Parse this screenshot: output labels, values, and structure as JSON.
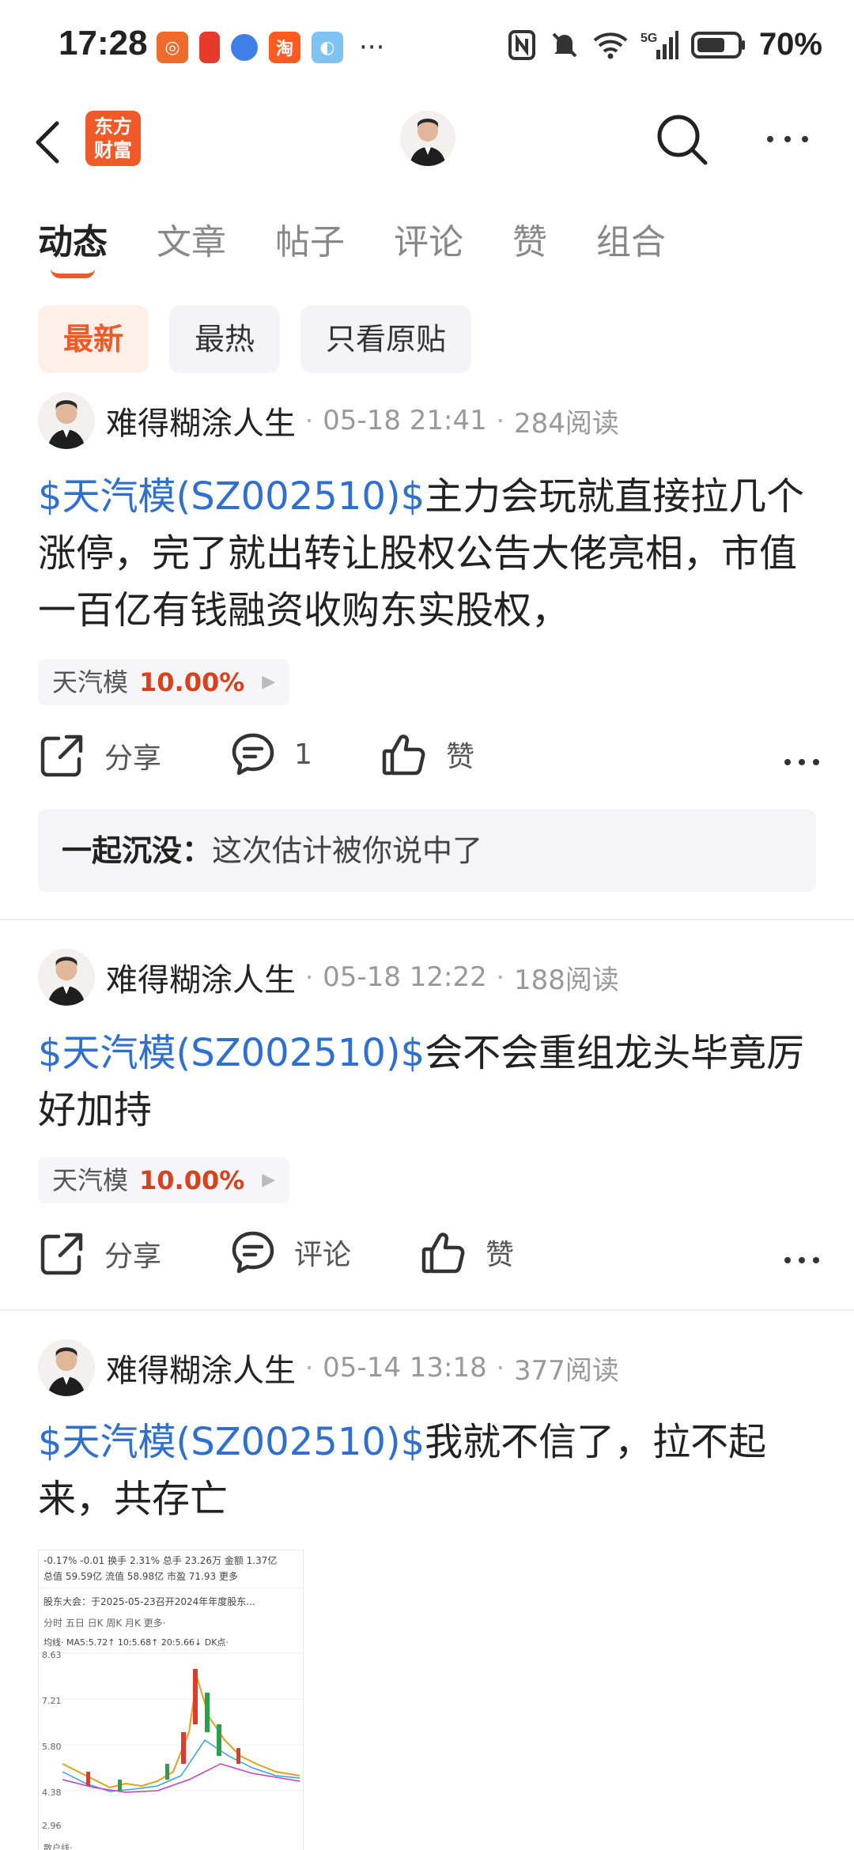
{
  "status_bar": {
    "time": "17:28",
    "battery": "70%",
    "network": "5G"
  },
  "header": {
    "logo_text_1": "东方",
    "logo_text_2": "财富"
  },
  "tabs": [
    {
      "label": "动态",
      "active": true
    },
    {
      "label": "文章"
    },
    {
      "label": "帖子"
    },
    {
      "label": "评论"
    },
    {
      "label": "赞"
    },
    {
      "label": "组合"
    }
  ],
  "filters": [
    {
      "label": "最新",
      "active": true
    },
    {
      "label": "最热"
    },
    {
      "label": "只看原贴"
    }
  ],
  "posts": [
    {
      "author": "难得糊涂人生",
      "time": "05-18 21:41",
      "reads": "284阅读",
      "stock_link": "$天汽模(SZ002510)$",
      "text": "主力会玩就直接拉几个涨停，完了就出转让股权公告大佬亮相，市值一百亿有钱融资收购东实股权，",
      "stock_name": "天汽模",
      "stock_change": "10.00%",
      "share_label": "分享",
      "comment_label": "1",
      "like_label": "赞",
      "comment": {
        "author": "一起沉没",
        "sep": "：",
        "text": "这次估计被你说中了"
      }
    },
    {
      "author": "难得糊涂人生",
      "time": "05-18 12:22",
      "reads": "188阅读",
      "stock_link": "$天汽模(SZ002510)$",
      "text": "会不会重组龙头毕竟厉好加持",
      "stock_name": "天汽模",
      "stock_change": "10.00%",
      "share_label": "分享",
      "comment_label": "评论",
      "like_label": "赞"
    },
    {
      "author": "难得糊涂人生",
      "time": "05-14 13:18",
      "reads": "377阅读",
      "stock_link": "$天汽模(SZ002510)$",
      "text": "我就不信了，拉不起来，共存亡"
    }
  ],
  "thumbnail": {
    "row1": "-0.17%  -0.01  换手 2.31%  总手 23.26万  金额 1.37亿",
    "row2": "总值 59.59亿  流值 58.98亿  市盈 71.93  更多",
    "row3": "股东大会：于2025-05-23召开2024年年度股东...",
    "tabs": "分时   五日   日K   周K   月K   更多·",
    "ma": "均线·  MA5:5.72↑ 10:5.68↑ 20:5.66↓   DK点·",
    "price_high": "8.63",
    "price_mid": "7.21",
    "price_mid2": "5.80",
    "price_low": "4.38",
    "price_min": "2.96",
    "bottom": "散户线·"
  }
}
